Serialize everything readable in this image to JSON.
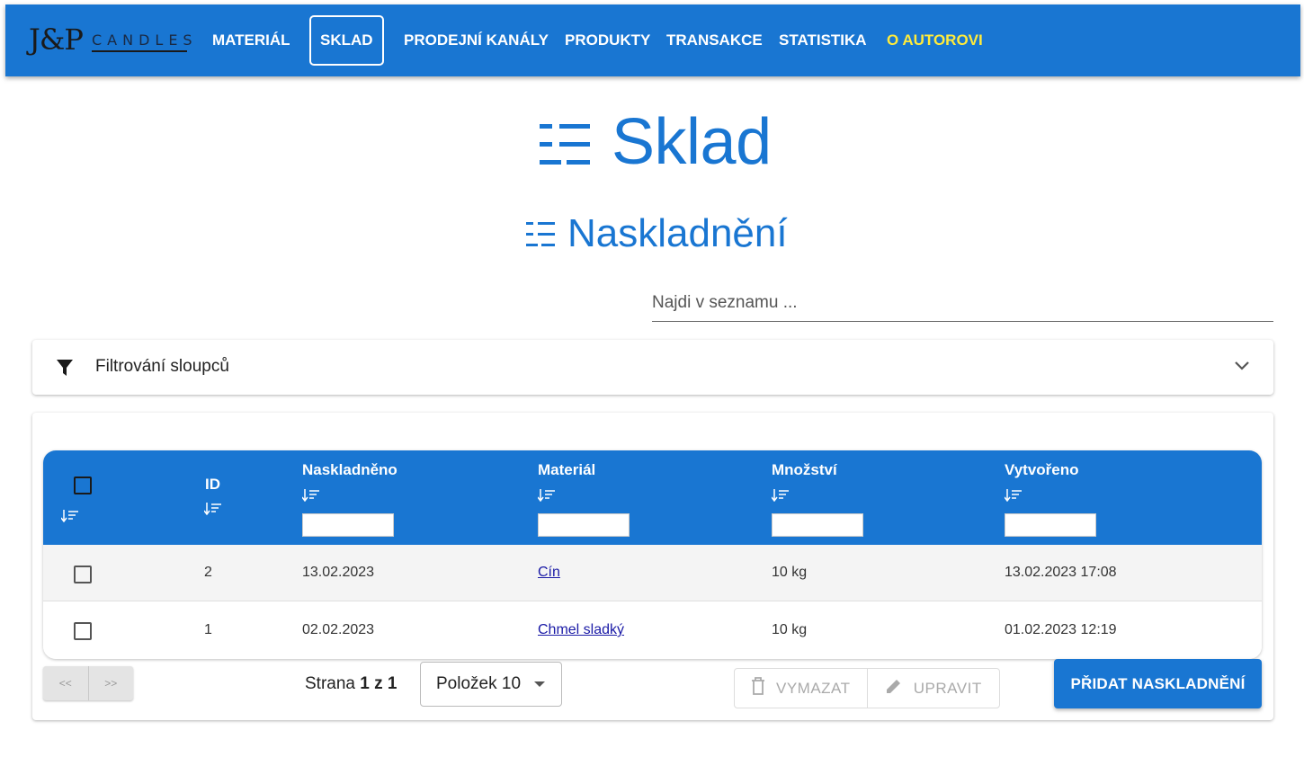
{
  "nav": {
    "logo_main": "J&P",
    "logo_sub": "CANDLES",
    "items": [
      {
        "label": "MATERIÁL"
      },
      {
        "label": "SKLAD"
      },
      {
        "label": "PRODEJNÍ KANÁLY"
      },
      {
        "label": "PRODUKTY"
      },
      {
        "label": "TRANSAKCE"
      },
      {
        "label": "STATISTIKA"
      },
      {
        "label": "O AUTOROVI"
      }
    ],
    "active": "SKLAD",
    "accent_color": "#1976d2",
    "highlight_color": "#ffeb3b"
  },
  "page": {
    "title": "Sklad",
    "section_title": "Naskladnění",
    "title_icon": "list-icon"
  },
  "search": {
    "placeholder": "Najdi v seznamu ...",
    "value": ""
  },
  "filter": {
    "label": "Filtrování sloupců",
    "icon": "filter-icon",
    "expand_icon": "chevron-down-icon"
  },
  "table": {
    "columns": [
      "ID",
      "Naskladněno",
      "Materiál",
      "Množství",
      "Vytvořeno"
    ],
    "rows": [
      {
        "id": "2",
        "date": "13.02.2023",
        "material": "Cín",
        "qty": "10 kg",
        "created": "13.02.2023 17:08"
      },
      {
        "id": "1",
        "date": "02.02.2023",
        "material": "Chmel sladký",
        "qty": "10 kg",
        "created": "01.02.2023 12:19"
      }
    ]
  },
  "footer": {
    "prev": "<<",
    "next": ">>",
    "page_prefix": "Strana",
    "page_value": "1 z 1",
    "per_page": "Položek 10",
    "delete": "VYMAZAT",
    "edit": "UPRAVIT",
    "add": "PŘIDAT NASKLADNĚNÍ"
  }
}
